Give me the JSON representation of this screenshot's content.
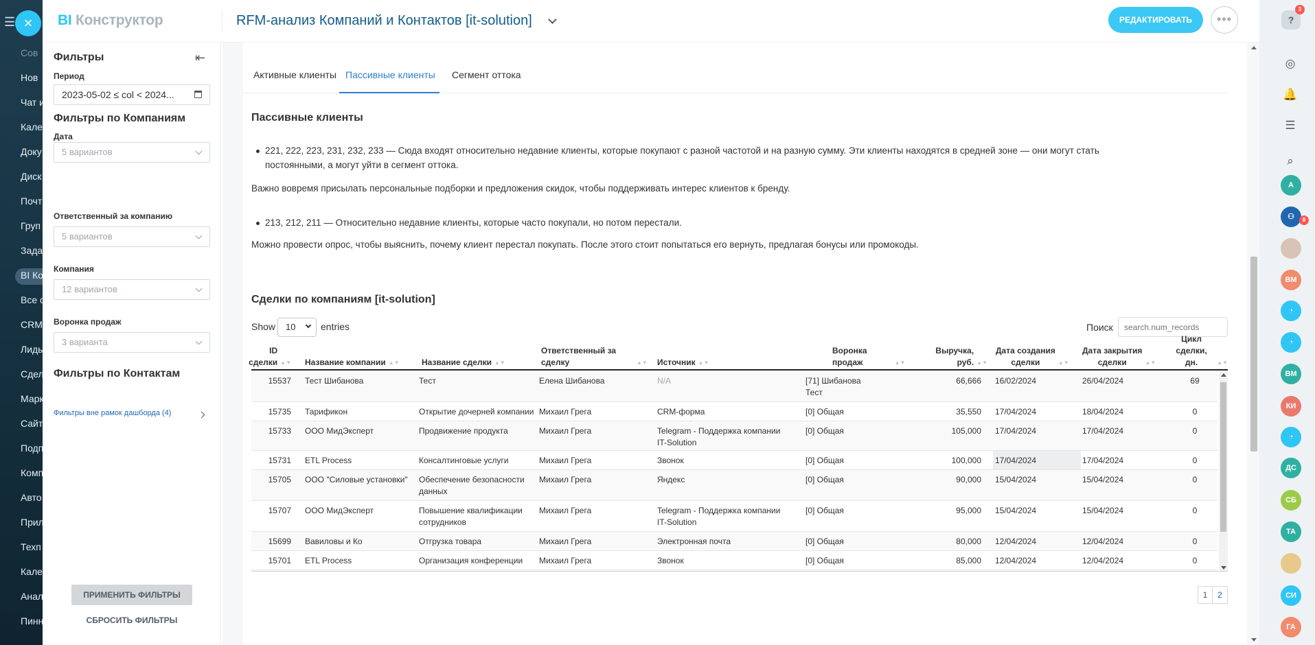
{
  "background_menu": {
    "items": [
      "Сов",
      "Нов",
      "Чат и",
      "Кале",
      "Доку",
      "Диск",
      "Почт",
      "Груп",
      "Зада",
      "BI Ко",
      "Все о",
      "CRM",
      "Лиды",
      "Сдел",
      "Марк",
      "Сайт",
      "Подп",
      "Комп",
      "Авто",
      "Прил",
      "Техп",
      "Кале",
      "Анал",
      "Пинн"
    ]
  },
  "header": {
    "logo_bi": "BI",
    "logo_text": "Конструктор",
    "title": "RFM-анализ Компаний и Контактов [it-solution]",
    "edit_button": "РЕДАКТИРОВАТЬ",
    "more_button": "•••"
  },
  "filters": {
    "title": "Фильтры",
    "period_label": "Период",
    "period_value": "2023-05-02 ≤ col < 2024...",
    "company_filters_title": "Фильтры по Компаниям",
    "date_label": "Дата",
    "date_value": "5 вариантов",
    "owner_label": "Ответственный за компанию",
    "owner_value": "5 вариантов",
    "company_label": "Компания",
    "company_value": "12 вариантов",
    "funnel_label": "Воронка продаж",
    "funnel_value": "3 варианта",
    "contact_filters_title": "Фильтры по Контактам",
    "outside_filters": "Фильтры вне рамок дашборда (4)",
    "apply_button": "ПРИМЕНИТЬ ФИЛЬТРЫ",
    "reset_button": "СБРОСИТЬ ФИЛЬТРЫ"
  },
  "tabs": [
    {
      "label": "Активные клиенты"
    },
    {
      "label": "Пассивные клиенты"
    },
    {
      "label": "Сегмент оттока"
    }
  ],
  "section": {
    "title": "Пассивные клиенты",
    "bullet1_line1": "221, 222, 223, 231, 232, 233 — Сюда входят относительно недавние клиенты, которые покупают с разной частотой и на разную сумму. Эти клиенты находятся в средней зоне — они могут стать",
    "bullet1_line2": "постоянными, а могут уйти в сегмент оттока.",
    "para1": "Важно вовремя присылать персональные подборки и предложения скидок, чтобы поддерживать интерес клиентов к бренду.",
    "bullet2": "213, 212, 211 — Относительно недавние клиенты, которые часто покупали, но потом перестали.",
    "para2": "Можно провести опрос, чтобы выяснить, почему клиент перестал покупать. После этого стоит попытаться его вернуть, предлагая бонусы или промокоды."
  },
  "deals": {
    "title": "Сделки по компаниям [it-solution]",
    "show_label": "Show",
    "page_size": "10",
    "entries_label": "entries",
    "search_label": "Поиск",
    "search_placeholder": "search.num_records",
    "columns": {
      "id_l1": "ID",
      "id_l2": "сделки",
      "company": "Название компании",
      "deal": "Название сделки",
      "owner_l1": "Ответственный за",
      "owner_l2": "сделку",
      "source": "Источник",
      "funnel_l1": "Воронка",
      "funnel_l2": "продаж",
      "revenue_l1": "Выручка,",
      "revenue_l2": "руб.",
      "created_l1": "Дата создания",
      "created_l2": "сделки",
      "closed_l1": "Дата закрытия",
      "closed_l2": "сделки",
      "cycle_l1": "Цикл сделки,",
      "cycle_l2": "дн."
    },
    "rows": [
      {
        "id": "15537",
        "company": "Тест Шибанова",
        "deal": "Тест",
        "deal2": "",
        "owner": "Елена Шибанова",
        "source": "N/A",
        "source2": "",
        "funnel": "[71] Шибанова",
        "funnel2": "Тест",
        "revenue": "66,666",
        "created": "16/02/2024",
        "closed": "26/04/2024",
        "cycle": "69"
      },
      {
        "id": "15735",
        "company": "Тарификон",
        "deal": "Открытие дочерней компании",
        "deal2": "",
        "owner": "Михаил Грега",
        "source": "CRM-форма",
        "source2": "",
        "funnel": "[0] Общая",
        "funnel2": "",
        "revenue": "35,550",
        "created": "17/04/2024",
        "closed": "18/04/2024",
        "cycle": "0"
      },
      {
        "id": "15733",
        "company": "ООО МидЭксперт",
        "deal": "Продвижение продукта",
        "deal2": "",
        "owner": "Михаил Грега",
        "source": "Telegram - Поддержка компании",
        "source2": "IT-Solution",
        "funnel": "[0] Общая",
        "funnel2": "",
        "revenue": "105,000",
        "created": "17/04/2024",
        "closed": "17/04/2024",
        "cycle": "0"
      },
      {
        "id": "15731",
        "company": "ETL Process",
        "deal": "Консалтинговые услуги",
        "deal2": "",
        "owner": "Михаил Грега",
        "source": "Звонок",
        "source2": "",
        "funnel": "[0] Общая",
        "funnel2": "",
        "revenue": "100,000",
        "created": "17/04/2024",
        "closed": "17/04/2024",
        "cycle": "0"
      },
      {
        "id": "15705",
        "company": "ООО \"Силовые установки\"",
        "deal": "Обеспечение безопасности",
        "deal2": "данных",
        "owner": "Михаил Грега",
        "source": "Яндекс",
        "source2": "",
        "funnel": "[0] Общая",
        "funnel2": "",
        "revenue": "90,000",
        "created": "15/04/2024",
        "closed": "15/04/2024",
        "cycle": "0"
      },
      {
        "id": "15707",
        "company": "ООО МидЭксперт",
        "deal": "Повышение квалификации",
        "deal2": "сотрудников",
        "owner": "Михаил Грега",
        "source": "Telegram - Поддержка компании",
        "source2": "IT-Solution",
        "funnel": "[0] Общая",
        "funnel2": "",
        "revenue": "95,000",
        "created": "15/04/2024",
        "closed": "15/04/2024",
        "cycle": "0"
      },
      {
        "id": "15699",
        "company": "Вавиловы и Ко",
        "deal": "Отгрузка товара",
        "deal2": "",
        "owner": "Михаил Грега",
        "source": "Электронная почта",
        "source2": "",
        "funnel": "[0] Общая",
        "funnel2": "",
        "revenue": "80,000",
        "created": "12/04/2024",
        "closed": "12/04/2024",
        "cycle": "0"
      },
      {
        "id": "15701",
        "company": "ETL Process",
        "deal": "Организация конференции",
        "deal2": "",
        "owner": "Михаил Грега",
        "source": "Звонок",
        "source2": "",
        "funnel": "[0] Общая",
        "funnel2": "",
        "revenue": "85,000",
        "created": "12/04/2024",
        "closed": "12/04/2024",
        "cycle": "0"
      }
    ],
    "pages": [
      "1",
      "2"
    ]
  },
  "right_bar": {
    "help_badge": "3",
    "chat_badge": "8",
    "avatars": [
      "А",
      "ВМ",
      "ВМ",
      "КИ",
      "ДС",
      "СБ",
      "ТА",
      "СИ",
      "ГА"
    ],
    "colors": {
      "teal": "#2fc6f6",
      "green": "#2fb0a3",
      "orange": "#f08b6c",
      "red": "#e9796d",
      "lime": "#9ccb4a",
      "navy": "#2067b0"
    }
  }
}
